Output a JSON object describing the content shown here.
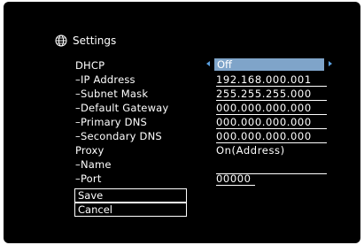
{
  "header": {
    "title": "Settings",
    "icon": "globe-icon"
  },
  "accent_color": "#7fa4c9",
  "fields": {
    "dhcp": {
      "label": "DHCP",
      "value": "Off"
    },
    "ip_address": {
      "label": "–IP Address",
      "value": "192.168.000.001"
    },
    "subnet_mask": {
      "label": "–Subnet Mask",
      "value": "255.255.255.000"
    },
    "default_gateway": {
      "label": "–Default Gateway",
      "value": "000.000.000.000"
    },
    "primary_dns": {
      "label": "–Primary DNS",
      "value": "000.000.000.000"
    },
    "secondary_dns": {
      "label": "–Secondary DNS",
      "value": "000.000.000.000"
    },
    "proxy": {
      "label": "Proxy",
      "value": "On(Address)"
    },
    "name": {
      "label": "–Name",
      "value": ""
    },
    "port": {
      "label": "–Port",
      "value": "00000"
    }
  },
  "buttons": {
    "save": "Save",
    "cancel": "Cancel"
  }
}
